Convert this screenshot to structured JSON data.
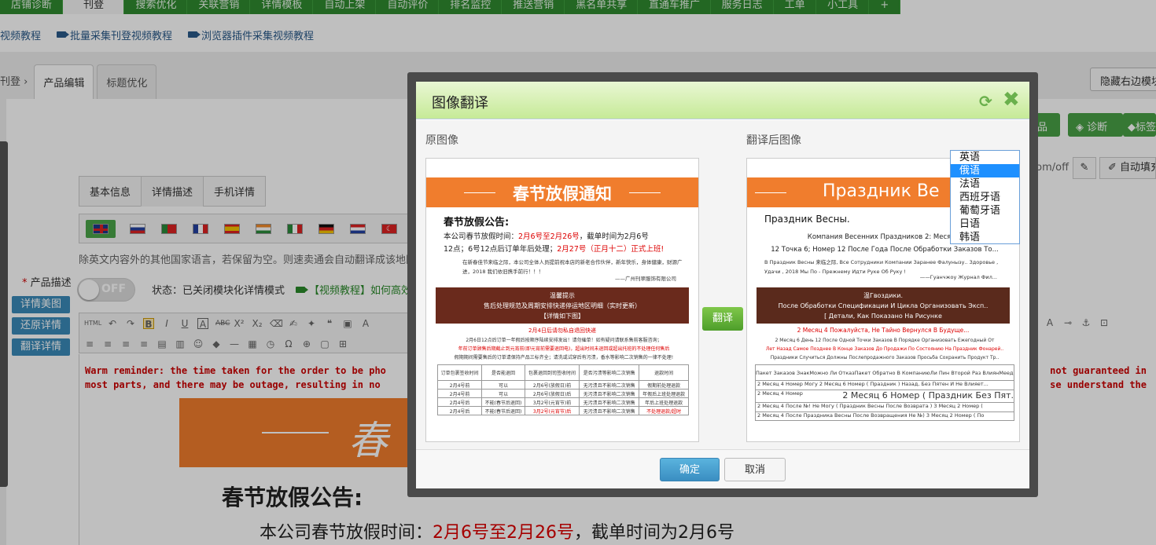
{
  "topnav": {
    "items": [
      "店铺诊断",
      "刊登",
      "搜索优化",
      "关联营销",
      "详情模板",
      "自动上架",
      "自动评价",
      "排名监控",
      "推送营销",
      "黑名单共享",
      "直通车推广",
      "服务日志",
      "工单",
      "小工具",
      "+"
    ],
    "active_index": 1
  },
  "videobar": {
    "items": [
      "视频教程",
      "批量采集刊登视频教程",
      "浏览器插件采集视频教程"
    ]
  },
  "pagetabs": {
    "crumb": "刊登",
    "arrow": "›",
    "tabs": [
      "产品编辑",
      "标题优化"
    ]
  },
  "right_buttons": {
    "hide_panel": "隐藏右边模块",
    "products": "产品",
    "diagnose": "诊断",
    "label": "标签",
    "url_suffix": "com/off",
    "autofill": "自动填充"
  },
  "subtabs": [
    "基本信息",
    "详情描述",
    "手机详情"
  ],
  "note": "除英文内容外的其他国家语言，若保留为空。则速卖通会自动翻译成该地区",
  "desc_label": "产品描述",
  "required_star": "*",
  "toggle": "OFF",
  "status": "状态：已关闭模块化详情模式",
  "video_link": "【视频教程】如何高效",
  "side_buttons": [
    "详情美图",
    "还原详情",
    "翻译详情"
  ],
  "editor": {
    "warm_reminder_left": "Warm reminder: the time taken for the order to be pho",
    "warm_reminder_left2": "most parts, and there may be outage, resulting in no",
    "warm_reminder_right": "not guaranteed in",
    "warm_reminder_right2": "se understand the",
    "banner_title": "春节",
    "big_title": "春节放假公告:",
    "body_prefix": "本公司春节放假时间：",
    "body_red": "2月6号至2月26号",
    "body_suffix": "，截单时间为2月6号"
  },
  "modal": {
    "title": "图像翻译",
    "original_label": "原图像",
    "translated_label": "翻译后图像",
    "translate_button": "翻译",
    "ok_button": "确定",
    "cancel_button": "取消",
    "language_selected": "俄语",
    "language_options": [
      "英语",
      "俄语",
      "法语",
      "西班牙语",
      "葡萄牙语",
      "日语",
      "韩语"
    ]
  },
  "original_image": {
    "banner": "春节放假通知",
    "heading": "春节放假公告:",
    "line1_a": "本公司春节放假时间：",
    "line1_red": "2月6号至2月26号",
    "line1_b": "，截单时间为2月6号",
    "line2_a": "12点；6号12点后订单年后处理；",
    "line2_red": "2月27号（正月十二）正式上班!",
    "para": "在新春佳节来临之际，本公司全体人员提前祝本店的新老合作伙伴，新年快乐，身体健康，财源广进，2018 我们依旧携手前行！！！",
    "sign": "——广州刊翠服饰有限公司",
    "dark_l1": "温馨提示",
    "dark_l2": "售后处理规范及周期安排快递停运地区明细（实时更新）",
    "dark_l3": "【详情如下图】",
    "red_note": "2月4日后请勿私自退回快递",
    "small1": "2月6日12点后订单一年假后按顺序陆续安排发出！请勿催单！如有疑问请联系售前客服咨询；",
    "small2_red": "年前订单顾售后期截止到元宵前(即元宵前需要退回电)，超出时间未退回或超出托班的不处理任何售后",
    "small3": "假期期间需要售后的订单请保持产品三标齐全；请洗或试穿后有污渍，香水等影响二次销售的一律不处理!",
    "table_header": [
      "订单包裹签收时间",
      "是否能退回",
      "包裹退回到司签收时间",
      "是否污渍等影响二次销售",
      "退款时间"
    ],
    "table_rows": [
      [
        "2月4号前",
        "可以",
        "2月6号(放假日)前",
        "无污渍且不影响二次销售",
        "假期前处理退款"
      ],
      [
        "2月4号前",
        "可以",
        "2月6号(放假日)后",
        "无污渍且不影响二次销售",
        "年假后上班处理退款"
      ],
      [
        "2月4号后",
        "不能(春节后退回)",
        "3月2号(元宵节)前",
        "无污渍且不影响二次销售",
        "年后上班处理退款"
      ],
      [
        "2月4号后",
        "不能(春节后退回)",
        "3月2号(元宵节)后",
        "无污渍且不影响二次销售",
        "不处理退款/超时"
      ]
    ]
  },
  "translated_image": {
    "banner": "Праздник Ве",
    "heading": "Праздник Весны.",
    "line1": "Компания Весенних Праздников 2: Месяц 6",
    "line2": "12 Точка 6; Номер 12 После Года После Обработки Заказов То...",
    "para": "В Праздник Весны 来临之际, Все Сотрудники Компании Заранее Фалунызу.. Здоровье , Удачи , 2018 Мы По - Прежнему Идти Руке Об Руку !",
    "sign": "——Гуанчжоу Журнал Фил...",
    "dark_l1": "温Гвоздики.",
    "dark_l2": "После Обработки Спецификации И Цикла Организовать Эксп..",
    "dark_l3": "[ Детали, Как Показано На Рисунке",
    "red_note": "2 Месяц 4 Пожалуйста, Не Тайно Вернулся В Будуще...",
    "small1": "2 Месяц 6 День 12 После Одной Точки Заказов В Порядке Организовать Ежегодный От",
    "small2_red": "Лет Назад Самое Позднее В Конце Заказов До Продажи По Состоянию На Праздник Фонарей..",
    "small3": "Праздники Случиться Должны Послепродажного Заказов Просьба Сохранить Продукт Тр..",
    "table_header": [
      "Пакет Заказов Знак",
      "Можно Ли Отказ",
      "Пакет Обратно В Компанию",
      "Ли Пин Второй Раз ВлиянМеедв Возврат..."
    ],
    "row1": "2 Месяц 4 Номер  Могу  2 Месяц 6 Номер ( Праздник ) Назад, Без Пятен И Не Влияет...",
    "row2_big": "2 Месяц 6 Номер ( Праздник Без Пят.",
    "row2_left": "2 Месяц 4 Номер",
    "row3": "2 Месяц 4 После №! Не Могу ( Праздник Весны После Возврата ) 3 Месяц 2 Номер (",
    "row4": "2 Месяц 4 После Праздника Весны После Возвращения Не №) 3 Месяц 2 Номер ( По"
  }
}
